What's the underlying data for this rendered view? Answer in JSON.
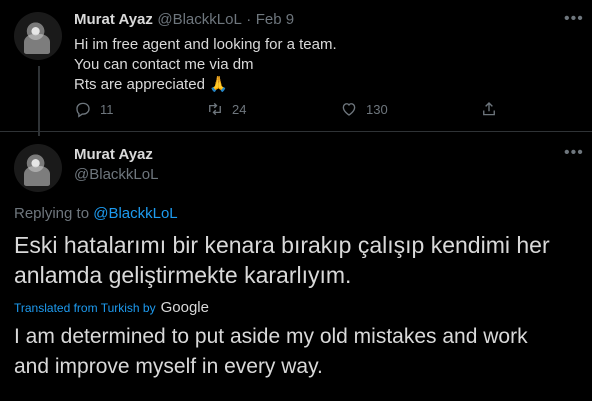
{
  "tweet1": {
    "name": "Murat Ayaz",
    "handle": "@BlackkLoL",
    "separator": "·",
    "date": "Feb 9",
    "lines": [
      "Hi im free agent and looking for a team.",
      "You can contact me via dm",
      "Rts are appreciated"
    ],
    "emoji": "🙏",
    "reply_count": "11",
    "retweet_count": "24",
    "like_count": "130"
  },
  "tweet2": {
    "name": "Murat Ayaz",
    "handle": "@BlackkLoL",
    "replying_prefix": "Replying to",
    "replying_handle": "@BlackkLoL",
    "text_lines": [
      "Eski hatalarımı bir kenara bırakıp çalışıp kendimi her",
      "anlamda geliştirmekte kararlıyım."
    ],
    "translated_from": "Translated from Turkish by",
    "translator": "Google",
    "translation_lines": [
      "I am determined to put aside my old mistakes and work",
      "and improve myself in every way."
    ]
  },
  "icons": {
    "more": "more-icon",
    "reply": "reply-icon",
    "retweet": "retweet-icon",
    "like": "heart-icon",
    "share": "share-icon"
  },
  "colors": {
    "background": "#000000",
    "text": "#d9d9d9",
    "secondary": "#6e767d",
    "link": "#1d9bf0",
    "divider": "#2f3336"
  }
}
